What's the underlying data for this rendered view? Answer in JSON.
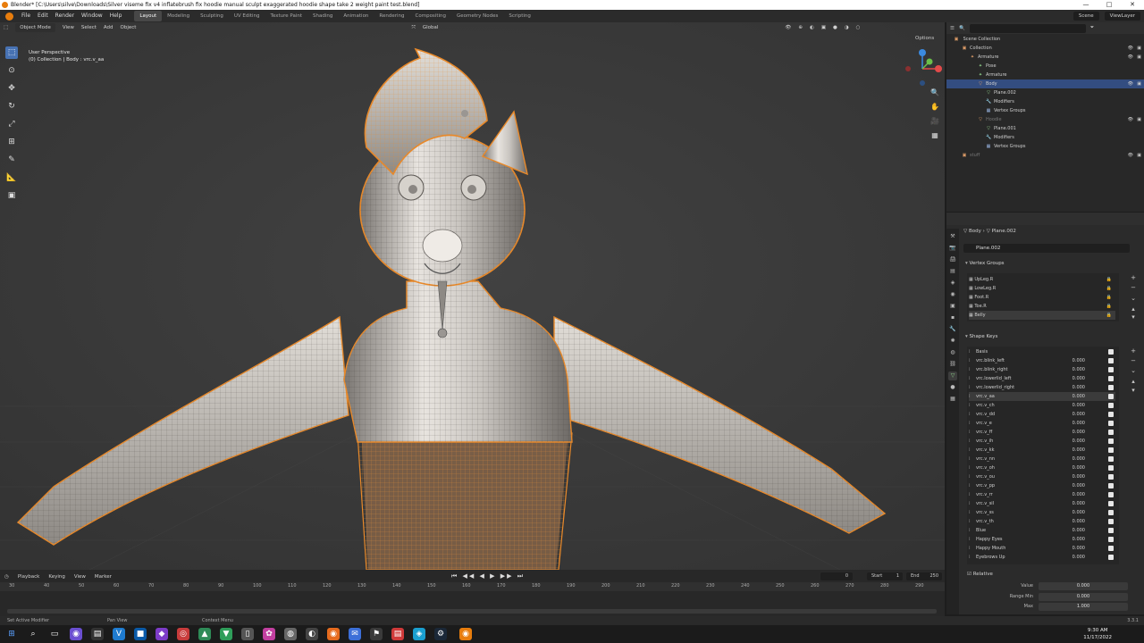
{
  "window": {
    "title": "Blender* [C:\\Users\\silve\\Downloads\\Silver viseme fix v4 inflatebrush fix hoodie manual sculpt exaggerated hoodie shape take 2 weight paint test.blend]",
    "min": "—",
    "max": "□",
    "close": "✕"
  },
  "menu": [
    "File",
    "Edit",
    "Render",
    "Window",
    "Help"
  ],
  "workspaces": [
    "Layout",
    "Modeling",
    "Sculpting",
    "UV Editing",
    "Texture Paint",
    "Shading",
    "Animation",
    "Rendering",
    "Compositing",
    "Geometry Nodes",
    "Scripting"
  ],
  "active_workspace": "Layout",
  "topright": {
    "scene": "Scene",
    "view_layer": "ViewLayer"
  },
  "viewport": {
    "mode": "Object Mode",
    "menus": [
      "View",
      "Select",
      "Add",
      "Object"
    ],
    "orientation": "Global",
    "options": "Options",
    "info_line1": "User Perspective",
    "info_line2": "(0) Collection | Body : vrc.v_aa"
  },
  "outliner": {
    "root": "Scene Collection",
    "rows": [
      {
        "label": "Collection",
        "indent": 1,
        "icon": "▣"
      },
      {
        "label": "Armature",
        "indent": 2,
        "icon": "✦"
      },
      {
        "label": "Pose",
        "indent": 3,
        "icon": "✦",
        "green": true
      },
      {
        "label": "Armature",
        "indent": 3,
        "icon": "✦",
        "green": true
      },
      {
        "label": "Body",
        "indent": 3,
        "icon": "▽",
        "sel": true
      },
      {
        "label": "Plane.002",
        "indent": 4,
        "icon": "▽",
        "green": true
      },
      {
        "label": "Modifiers",
        "indent": 4,
        "icon": "🔧",
        "blue": true
      },
      {
        "label": "Vertex Groups",
        "indent": 4,
        "icon": "▦",
        "blue": true
      },
      {
        "label": "Hoodie",
        "indent": 3,
        "icon": "▽",
        "dim": true
      },
      {
        "label": "Plane.001",
        "indent": 4,
        "icon": "▽",
        "green": true
      },
      {
        "label": "Modifiers",
        "indent": 4,
        "icon": "🔧",
        "blue": true
      },
      {
        "label": "Vertex Groups",
        "indent": 4,
        "icon": "▦",
        "blue": true
      },
      {
        "label": "stuff",
        "indent": 1,
        "icon": "▣",
        "dim": true
      }
    ]
  },
  "properties": {
    "breadcrumb_object": "Body",
    "breadcrumb_mesh": "Plane.002",
    "mesh_name": "Plane.002",
    "vertex_groups_title": "Vertex Groups",
    "vertex_groups": [
      "UpLeg.R",
      "LowLeg.R",
      "Foot.R",
      "Toe.R",
      "Belly"
    ],
    "shape_keys_title": "Shape Keys",
    "shape_keys": [
      {
        "name": "Basis",
        "value": ""
      },
      {
        "name": "vrc.blink_left",
        "value": "0.000"
      },
      {
        "name": "vrc.blink_right",
        "value": "0.000"
      },
      {
        "name": "vrc.lowerlid_left",
        "value": "0.000"
      },
      {
        "name": "vrc.lowerlid_right",
        "value": "0.000"
      },
      {
        "name": "vrc.v_aa",
        "value": "0.000",
        "sel": true
      },
      {
        "name": "vrc.v_ch",
        "value": "0.000"
      },
      {
        "name": "vrc.v_dd",
        "value": "0.000"
      },
      {
        "name": "vrc.v_e",
        "value": "0.000"
      },
      {
        "name": "vrc.v_ff",
        "value": "0.000"
      },
      {
        "name": "vrc.v_ih",
        "value": "0.000"
      },
      {
        "name": "vrc.v_kk",
        "value": "0.000"
      },
      {
        "name": "vrc.v_nn",
        "value": "0.000"
      },
      {
        "name": "vrc.v_oh",
        "value": "0.000"
      },
      {
        "name": "vrc.v_ou",
        "value": "0.000"
      },
      {
        "name": "vrc.v_pp",
        "value": "0.000"
      },
      {
        "name": "vrc.v_rr",
        "value": "0.000"
      },
      {
        "name": "vrc.v_sil",
        "value": "0.000"
      },
      {
        "name": "vrc.v_ss",
        "value": "0.000"
      },
      {
        "name": "vrc.v_th",
        "value": "0.000"
      },
      {
        "name": "Blue",
        "value": "0.000"
      },
      {
        "name": "Happy Eyes",
        "value": "0.000"
      },
      {
        "name": "Happy Mouth",
        "value": "0.000"
      },
      {
        "name": "Eyebrows Up",
        "value": "0.000"
      }
    ],
    "relative_label": "Relative",
    "value_label": "Value",
    "value": "0.000",
    "range_min_label": "Range Min",
    "range_min": "0.000",
    "max_label": "Max",
    "max": "1.000"
  },
  "timeline": {
    "menus": [
      "Playback",
      "Keying",
      "View",
      "Marker"
    ],
    "current_frame": "0",
    "start_label": "Start",
    "start": "1",
    "end_label": "End",
    "end": "250",
    "ticks": [
      "30",
      "40",
      "50",
      "60",
      "70",
      "80",
      "90",
      "100",
      "110",
      "120",
      "130",
      "140",
      "150",
      "160",
      "170",
      "180",
      "190",
      "200",
      "210",
      "220",
      "230",
      "240",
      "250",
      "260",
      "270",
      "280",
      "290"
    ]
  },
  "status": {
    "left": "Set Active Modifier",
    "mid": "Pan View",
    "right": "Context Menu",
    "version": "3.3.1"
  },
  "clock": {
    "time": "9:30 AM",
    "date": "11/17/2022"
  },
  "colors": {
    "accent": "#4772b3",
    "select": "#e8892a",
    "blender_orange": "#e87d0d"
  }
}
